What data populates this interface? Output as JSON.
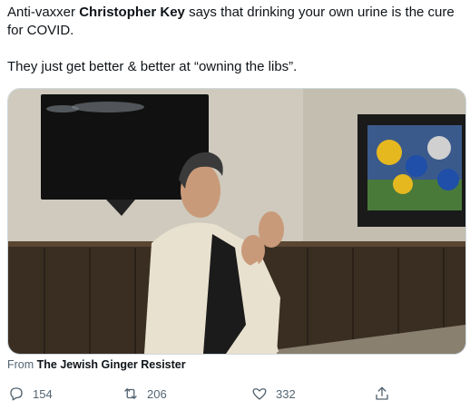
{
  "tweet": {
    "line1_prefix": "Anti-vaxxer ",
    "line1_name": "Christopher Key",
    "line1_suffix": " says that drinking your own urine is the cure for COVID.",
    "line2": "They just get better & better at “owning the libs”."
  },
  "attribution": {
    "from_label": "From",
    "source": "The Jewish Ginger Resister"
  },
  "actions": {
    "reply": {
      "icon": "reply-icon",
      "count": "154"
    },
    "retweet": {
      "icon": "retweet-icon",
      "count": "206"
    },
    "like": {
      "icon": "heart-icon",
      "count": "332"
    },
    "share": {
      "icon": "share-icon"
    }
  },
  "colors": {
    "text": "#0f1419",
    "muted": "#536471",
    "border": "#cfd9de"
  }
}
